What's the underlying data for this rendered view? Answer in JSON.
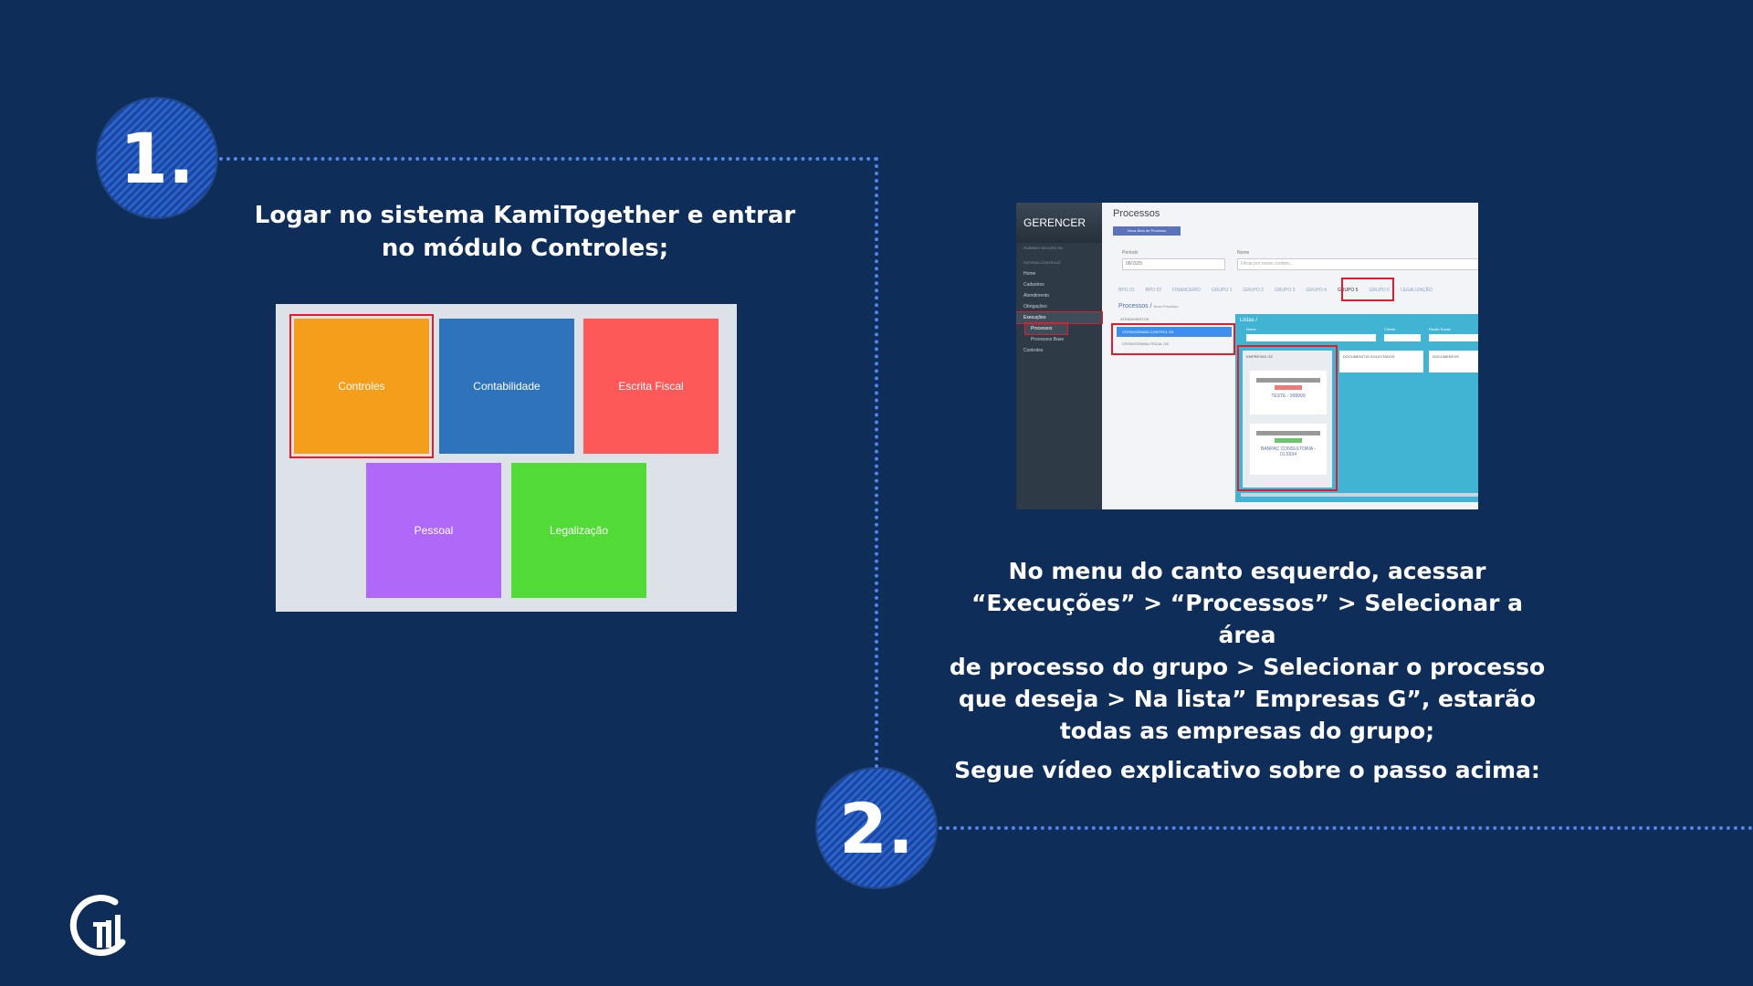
{
  "steps": {
    "one": {
      "number": "1.",
      "heading_line1": "Logar no sistema KamiTogether e entrar",
      "heading_line2": "no módulo Controles;"
    },
    "two": {
      "number": "2.",
      "lines": [
        "No menu do canto esquerdo, acessar",
        "“Execuções” > “Processos” > Selecionar a área",
        "de processo do grupo > Selecionar o processo",
        "que deseja > Na lista” Empresas G”, estarão",
        "todas as empresas do grupo;"
      ],
      "video_line": "Segue vídeo explicativo sobre o passo acima:"
    }
  },
  "tiles": [
    {
      "label": "Controles",
      "color": "#f59e1c"
    },
    {
      "label": "Contabilidade",
      "color": "#2e74bd"
    },
    {
      "label": "Escrita Fiscal",
      "color": "#fd5959"
    },
    {
      "label": "Pessoal",
      "color": "#af68f8"
    },
    {
      "label": "Legalização",
      "color": "#52db36"
    }
  ],
  "app": {
    "logo": "GERENCER",
    "user": "RUBINHO SEGURO 9D",
    "side_section": "SISTEMA CONTROLE",
    "side_items": [
      "Home",
      "Cadastros",
      "Atendimento",
      "Obrigações",
      "Execuções",
      "Processos",
      "Processos Base",
      "Controles"
    ],
    "title": "Processos",
    "new_area_button": "Nova Área de Processo",
    "period_label": "Período",
    "period_value": "08/2025",
    "name_label": "Nome",
    "name_placeholder": "Filtrar por nome contém...",
    "tabs": [
      "BPO 01",
      "BPO 02",
      "FINANCEIRO",
      "GRUPO 1",
      "GRUPO 2",
      "GRUPO 3",
      "GRUPO 4",
      "GRUPO 5",
      "GRUPO 6",
      "LEGALIZAÇÃO"
    ],
    "breadcrumb": "Processos /",
    "new_process": "Novo Processo",
    "attend": "ATENDIMENTOS",
    "processes": [
      "CRONOGRAMA CONTROL G5",
      "CRONOGRAMA FISCAL G5"
    ],
    "lists_label": "Listas /",
    "filter_name": "Nome",
    "filter_client": "Cliente",
    "filter_social": "Razão Social",
    "list_columns": [
      "EMPRESAS G5",
      "DOCUMENTOS SOLICITADOS",
      "DOCUMENTOS"
    ],
    "cards": [
      "TESTE - 999999",
      "BANPAC CONSULTORIA - 01.6934"
    ]
  },
  "colors": {
    "background": "#0e2d58",
    "accent": "#4f86ec",
    "highlight": "#e41b2b"
  },
  "logo_icon": "company-logo-icon"
}
